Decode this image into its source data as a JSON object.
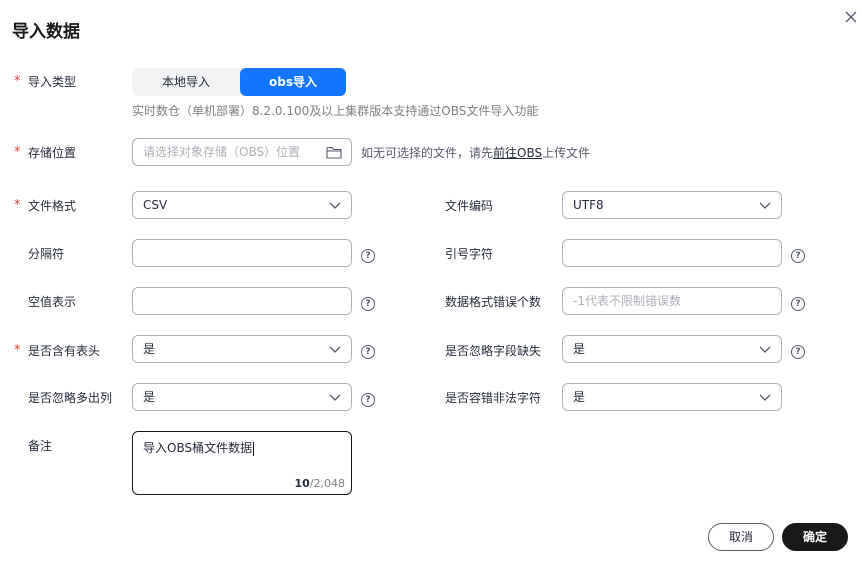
{
  "dialog": {
    "title": "导入数据"
  },
  "import_type": {
    "label": "导入类型",
    "options": [
      "本地导入",
      "obs导入"
    ],
    "selected": "obs导入",
    "hint": "实时数仓（单机部署）8.2.0.100及以上集群版本支持通过OBS文件导入功能"
  },
  "storage": {
    "label": "存储位置",
    "placeholder": "请选择对象存储（OBS）位置",
    "hint_before": "如无可选择的文件，请先",
    "hint_link": "前往OBS",
    "hint_after": "上传文件"
  },
  "file_format": {
    "label": "文件格式",
    "value": "CSV"
  },
  "file_encoding": {
    "label": "文件编码",
    "value": "UTF8"
  },
  "delimiter": {
    "label": "分隔符",
    "value": ""
  },
  "quote_char": {
    "label": "引号字符",
    "value": ""
  },
  "null_repr": {
    "label": "空值表示",
    "value": ""
  },
  "format_errors": {
    "label": "数据格式错误个数",
    "placeholder": "-1代表不限制错误数"
  },
  "has_header": {
    "label": "是否含有表头",
    "value": "是"
  },
  "ignore_missing": {
    "label": "是否忽略字段缺失",
    "value": "是"
  },
  "ignore_extra": {
    "label": "是否忽略多出列",
    "value": "是"
  },
  "tolerate_illegal": {
    "label": "是否容错非法字符",
    "value": "是"
  },
  "remark": {
    "label": "备注",
    "value": "导入OBS桶文件数据",
    "count": "10",
    "max": "/2,048"
  },
  "footer": {
    "cancel": "取消",
    "ok": "确定"
  },
  "required_mark": "*",
  "help_glyph": "?",
  "colors": {
    "primary": "#1476ff",
    "required": "#e7413f",
    "dark_button": "#191919"
  }
}
